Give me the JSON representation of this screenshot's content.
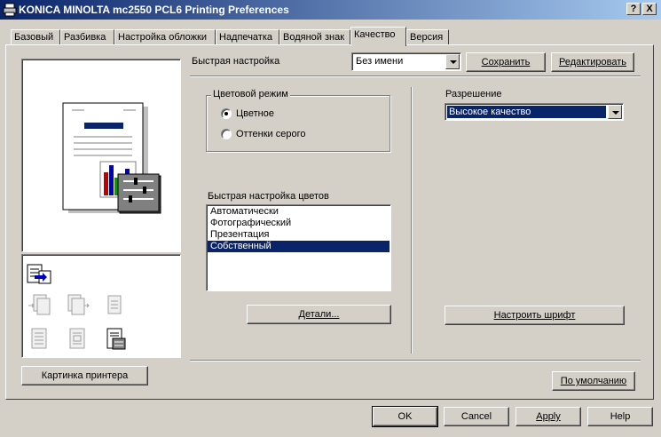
{
  "window": {
    "title": "KONICA MINOLTA mc2550 PCL6 Printing Preferences",
    "help_btn": "?",
    "close_btn": "X"
  },
  "tabs": [
    {
      "label": "Базовый"
    },
    {
      "label": "Разбивка"
    },
    {
      "label": "Настройка обложки"
    },
    {
      "label": "Надпечатка"
    },
    {
      "label": "Водяной знак"
    },
    {
      "label": "Качество"
    },
    {
      "label": "Версия"
    }
  ],
  "quick_setup": {
    "label": "Быстрая настройка",
    "value": "Без имени",
    "save": "Сохранить",
    "edit": "Редактировать"
  },
  "color_mode": {
    "legend": "Цветовой режим",
    "options": [
      {
        "label": "Цветное",
        "selected": true
      },
      {
        "label": "Оттенки серого",
        "selected": false
      }
    ]
  },
  "quick_color": {
    "label": "Быстрая настройка цветов",
    "items": [
      {
        "label": "Автоматически",
        "selected": false
      },
      {
        "label": "Фотографический",
        "selected": false
      },
      {
        "label": "Презентация",
        "selected": false
      },
      {
        "label": "Собственный",
        "selected": true
      }
    ],
    "details": "Детали..."
  },
  "resolution": {
    "label": "Разрешение",
    "value": "Высокое качество"
  },
  "font_settings": "Настроить шрифт",
  "printer_picture": "Картинка принтера",
  "defaults": "По умолчанию",
  "footer": {
    "ok": "OK",
    "cancel": "Cancel",
    "apply": "Apply",
    "help": "Help"
  },
  "colors": {
    "selection": "#0a246a",
    "face": "#d4d0c8"
  }
}
